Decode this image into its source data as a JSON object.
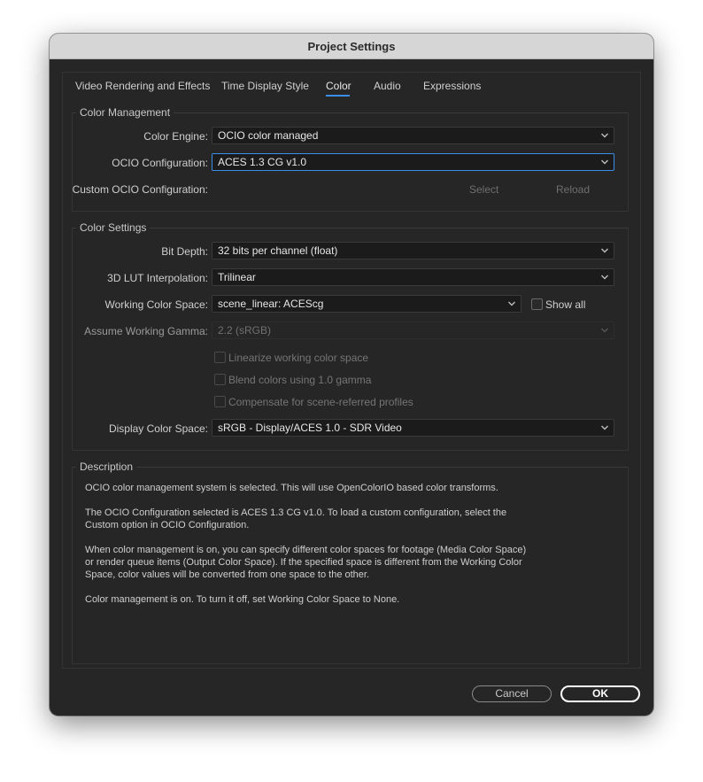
{
  "window": {
    "title": "Project Settings"
  },
  "tabs": [
    {
      "label": "Video Rendering and Effects"
    },
    {
      "label": "Time Display Style"
    },
    {
      "label": "Color",
      "active": true
    },
    {
      "label": "Audio"
    },
    {
      "label": "Expressions"
    }
  ],
  "color_management": {
    "title": "Color Management",
    "color_engine": {
      "label": "Color Engine:",
      "value": "OCIO color managed"
    },
    "ocio_config": {
      "label": "OCIO Configuration:",
      "value": "ACES 1.3 CG v1.0"
    },
    "custom_ocio": {
      "label": "Custom OCIO Configuration:",
      "select_label": "Select",
      "reload_label": "Reload"
    }
  },
  "color_settings": {
    "title": "Color Settings",
    "bit_depth": {
      "label": "Bit Depth:",
      "value": "32 bits per channel (float)"
    },
    "lut_interp": {
      "label": "3D LUT Interpolation:",
      "value": "Trilinear"
    },
    "working_space": {
      "label": "Working Color Space:",
      "value": "scene_linear: ACEScg"
    },
    "show_all": {
      "label": "Show all",
      "checked": false
    },
    "assume_gamma": {
      "label": "Assume Working Gamma:",
      "value": "2.2 (sRGB)"
    },
    "linearize": {
      "label": "Linearize working color space",
      "checked": false
    },
    "blend": {
      "label": "Blend colors using 1.0 gamma",
      "checked": false
    },
    "compensate": {
      "label": "Compensate for scene-referred profiles",
      "checked": false
    },
    "display_space": {
      "label": "Display Color Space:",
      "value": "sRGB - Display/ACES 1.0 - SDR Video"
    }
  },
  "description": {
    "title": "Description",
    "p1": "OCIO color management system is selected. This will use OpenColorIO based color transforms.",
    "p2": "The OCIO Configuration selected is ACES 1.3 CG v1.0. To load a custom configuration, select the Custom option in OCIO Configuration.",
    "p3": "When color management is on, you can specify different color spaces for footage (Media Color Space) or render queue items (Output Color Space). If the specified space is different from the Working Color Space, color values will be converted from one space to the other.",
    "p4": "Color management is on. To turn it off, set Working Color Space to None."
  },
  "footer": {
    "cancel_label": "Cancel",
    "ok_label": "OK"
  },
  "colors": {
    "accent": "#3b8ee6",
    "background": "#262626",
    "field": "#1b1b1b",
    "titlebar": "#d6d6d6"
  }
}
